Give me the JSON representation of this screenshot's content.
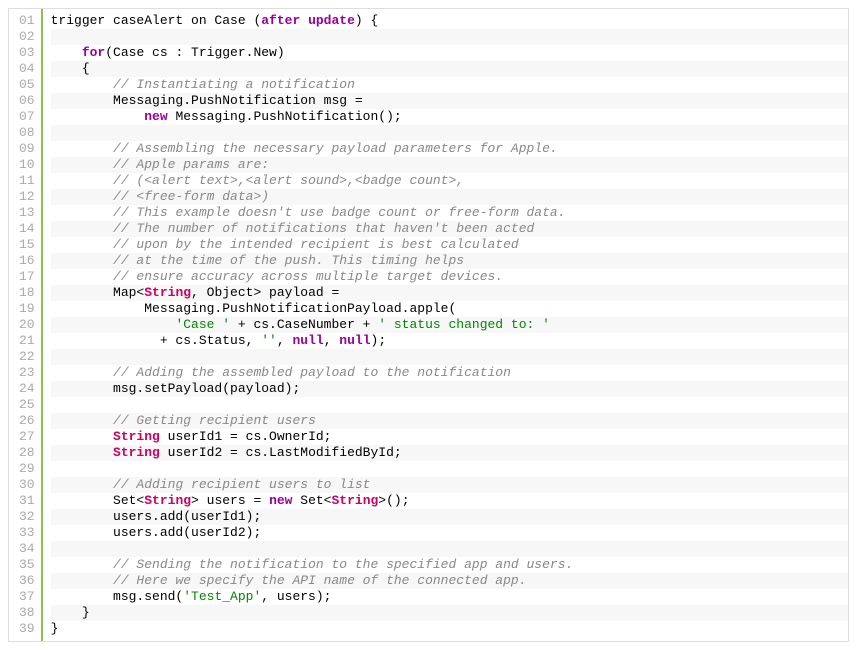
{
  "lineCount": 39,
  "lines": [
    {
      "n": "01",
      "segs": [
        {
          "t": "",
          "c": ""
        },
        {
          "t": "trigger caseAlert on Case (",
          "c": ""
        },
        {
          "t": "after",
          "c": "keyword-purple"
        },
        {
          "t": " ",
          "c": ""
        },
        {
          "t": "update",
          "c": "keyword-purple"
        },
        {
          "t": ") {",
          "c": ""
        }
      ]
    },
    {
      "n": "02",
      "segs": []
    },
    {
      "n": "03",
      "segs": [
        {
          "t": "    ",
          "c": ""
        },
        {
          "t": "for",
          "c": "keyword-purple"
        },
        {
          "t": "(Case cs : Trigger.New)",
          "c": ""
        }
      ]
    },
    {
      "n": "04",
      "segs": [
        {
          "t": "    {",
          "c": ""
        }
      ]
    },
    {
      "n": "05",
      "segs": [
        {
          "t": "        ",
          "c": ""
        },
        {
          "t": "// Instantiating a notification",
          "c": "comment"
        }
      ]
    },
    {
      "n": "06",
      "segs": [
        {
          "t": "        Messaging.PushNotification msg =",
          "c": ""
        }
      ]
    },
    {
      "n": "07",
      "segs": [
        {
          "t": "            ",
          "c": ""
        },
        {
          "t": "new",
          "c": "keyword-purple"
        },
        {
          "t": " Messaging.PushNotification();",
          "c": ""
        }
      ]
    },
    {
      "n": "08",
      "segs": []
    },
    {
      "n": "09",
      "segs": [
        {
          "t": "        ",
          "c": ""
        },
        {
          "t": "// Assembling the necessary payload parameters for Apple.",
          "c": "comment"
        }
      ]
    },
    {
      "n": "10",
      "segs": [
        {
          "t": "        ",
          "c": ""
        },
        {
          "t": "// Apple params are:",
          "c": "comment"
        }
      ]
    },
    {
      "n": "11",
      "segs": [
        {
          "t": "        ",
          "c": ""
        },
        {
          "t": "// (<alert text>,<alert sound>,<badge count>,",
          "c": "comment"
        }
      ]
    },
    {
      "n": "12",
      "segs": [
        {
          "t": "        ",
          "c": ""
        },
        {
          "t": "// <free-form data>)",
          "c": "comment"
        }
      ]
    },
    {
      "n": "13",
      "segs": [
        {
          "t": "        ",
          "c": ""
        },
        {
          "t": "// This example doesn't use badge count or free-form data.",
          "c": "comment"
        }
      ]
    },
    {
      "n": "14",
      "segs": [
        {
          "t": "        ",
          "c": ""
        },
        {
          "t": "// The number of notifications that haven't been acted",
          "c": "comment"
        }
      ]
    },
    {
      "n": "15",
      "segs": [
        {
          "t": "        ",
          "c": ""
        },
        {
          "t": "// upon by the intended recipient is best calculated",
          "c": "comment"
        }
      ]
    },
    {
      "n": "16",
      "segs": [
        {
          "t": "        ",
          "c": ""
        },
        {
          "t": "// at the time of the push. This timing helps",
          "c": "comment"
        }
      ]
    },
    {
      "n": "17",
      "segs": [
        {
          "t": "        ",
          "c": ""
        },
        {
          "t": "// ensure accuracy across multiple target devices.",
          "c": "comment"
        }
      ]
    },
    {
      "n": "18",
      "segs": [
        {
          "t": "        Map<",
          "c": ""
        },
        {
          "t": "String",
          "c": "type"
        },
        {
          "t": ", Object> payload =",
          "c": ""
        }
      ]
    },
    {
      "n": "19",
      "segs": [
        {
          "t": "            Messaging.PushNotificationPayload.apple(",
          "c": ""
        }
      ]
    },
    {
      "n": "20",
      "segs": [
        {
          "t": "                ",
          "c": ""
        },
        {
          "t": "'Case '",
          "c": "string"
        },
        {
          "t": " + cs.CaseNumber + ",
          "c": ""
        },
        {
          "t": "' status changed to: '",
          "c": "string"
        }
      ]
    },
    {
      "n": "21",
      "segs": [
        {
          "t": "              + cs.Status, ",
          "c": ""
        },
        {
          "t": "''",
          "c": "string"
        },
        {
          "t": ", ",
          "c": ""
        },
        {
          "t": "null",
          "c": "keyword-purple"
        },
        {
          "t": ", ",
          "c": ""
        },
        {
          "t": "null",
          "c": "keyword-purple"
        },
        {
          "t": ");",
          "c": ""
        }
      ]
    },
    {
      "n": "22",
      "segs": []
    },
    {
      "n": "23",
      "segs": [
        {
          "t": "        ",
          "c": ""
        },
        {
          "t": "// Adding the assembled payload to the notification",
          "c": "comment"
        }
      ]
    },
    {
      "n": "24",
      "segs": [
        {
          "t": "        msg.setPayload(payload);",
          "c": ""
        }
      ]
    },
    {
      "n": "25",
      "segs": []
    },
    {
      "n": "26",
      "segs": [
        {
          "t": "        ",
          "c": ""
        },
        {
          "t": "// Getting recipient users",
          "c": "comment"
        }
      ]
    },
    {
      "n": "27",
      "segs": [
        {
          "t": "        ",
          "c": ""
        },
        {
          "t": "String",
          "c": "type"
        },
        {
          "t": " userId1 = cs.OwnerId;",
          "c": ""
        }
      ]
    },
    {
      "n": "28",
      "segs": [
        {
          "t": "        ",
          "c": ""
        },
        {
          "t": "String",
          "c": "type"
        },
        {
          "t": " userId2 = cs.LastModifiedById;",
          "c": ""
        }
      ]
    },
    {
      "n": "29",
      "segs": []
    },
    {
      "n": "30",
      "segs": [
        {
          "t": "        ",
          "c": ""
        },
        {
          "t": "// Adding recipient users to list",
          "c": "comment"
        }
      ]
    },
    {
      "n": "31",
      "segs": [
        {
          "t": "        Set<",
          "c": ""
        },
        {
          "t": "String",
          "c": "type"
        },
        {
          "t": "> users = ",
          "c": ""
        },
        {
          "t": "new",
          "c": "keyword-purple"
        },
        {
          "t": " Set<",
          "c": ""
        },
        {
          "t": "String",
          "c": "type"
        },
        {
          "t": ">();",
          "c": ""
        }
      ]
    },
    {
      "n": "32",
      "segs": [
        {
          "t": "        users.add(userId1);",
          "c": ""
        }
      ]
    },
    {
      "n": "33",
      "segs": [
        {
          "t": "        users.add(userId2);",
          "c": ""
        }
      ]
    },
    {
      "n": "34",
      "segs": []
    },
    {
      "n": "35",
      "segs": [
        {
          "t": "        ",
          "c": ""
        },
        {
          "t": "// Sending the notification to the specified app and users.",
          "c": "comment"
        }
      ]
    },
    {
      "n": "36",
      "segs": [
        {
          "t": "        ",
          "c": ""
        },
        {
          "t": "// Here we specify the API name of the connected app.",
          "c": "comment"
        }
      ]
    },
    {
      "n": "37",
      "segs": [
        {
          "t": "        msg.send(",
          "c": ""
        },
        {
          "t": "'Test_App'",
          "c": "string"
        },
        {
          "t": ", users);",
          "c": ""
        }
      ]
    },
    {
      "n": "38",
      "segs": [
        {
          "t": "    }",
          "c": ""
        }
      ]
    },
    {
      "n": "39",
      "segs": [
        {
          "t": "}",
          "c": ""
        }
      ]
    }
  ]
}
